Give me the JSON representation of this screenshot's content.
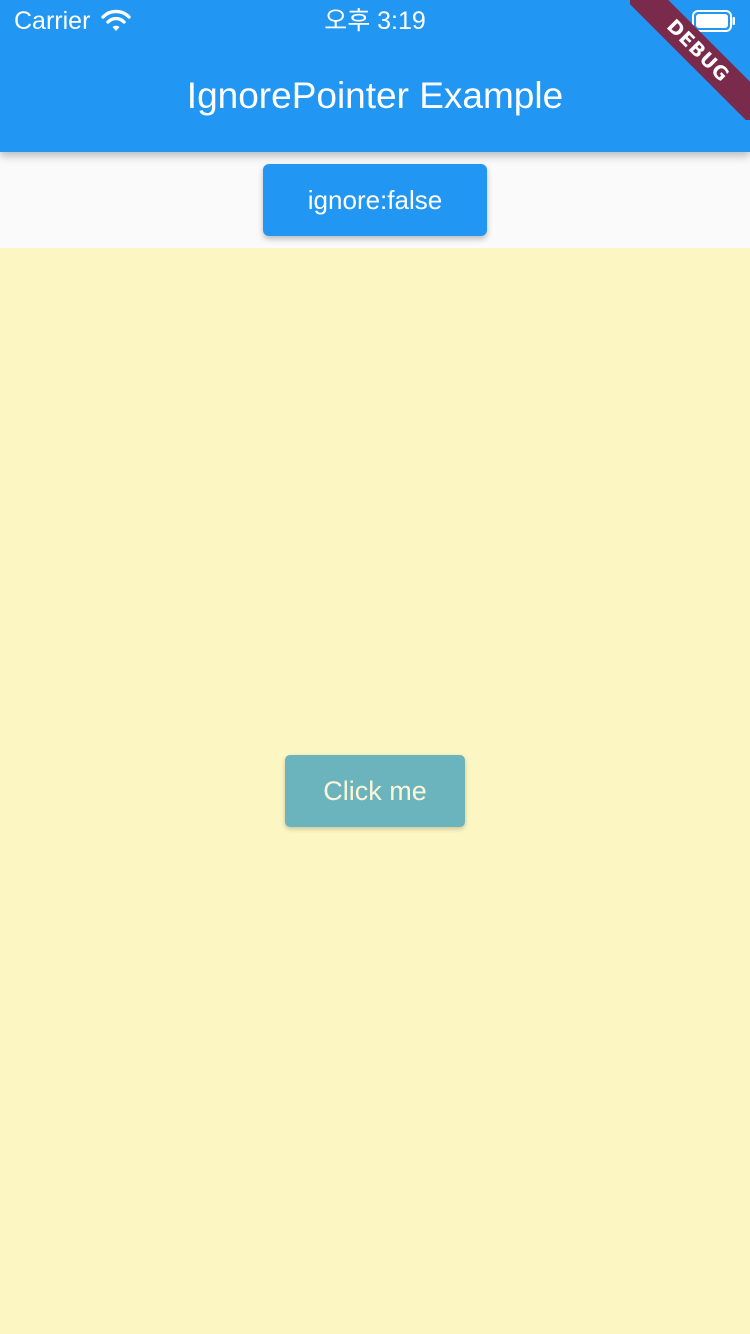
{
  "status_bar": {
    "carrier": "Carrier",
    "time": "오후 3:19",
    "icons": [
      "wifi-icon",
      "battery-icon"
    ]
  },
  "app_bar": {
    "title": "IgnorePointer Example",
    "background_color": "#2196F3"
  },
  "toolbar": {
    "ignore_button_label": "ignore:false"
  },
  "body": {
    "background_color": "#FCF6C3",
    "click_button_label": "Click me",
    "click_button_color": "#6BB4BE"
  },
  "debug_banner": {
    "label": "DEBUG",
    "color": "#7A2A4A"
  }
}
